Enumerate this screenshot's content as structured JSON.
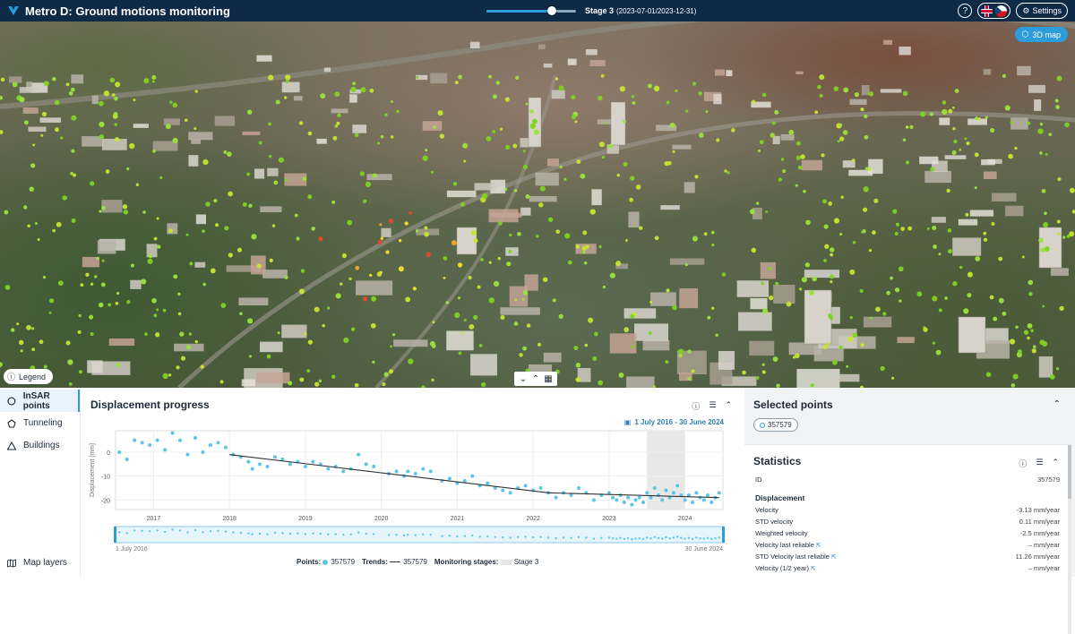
{
  "app": {
    "title": "Metro D: Ground motions monitoring"
  },
  "stage": {
    "label": "Stage 3",
    "dates": "(2023-07-01/2023-12-31)",
    "slider_fraction": 0.73
  },
  "header": {
    "help": "?",
    "settings_label": "Settings"
  },
  "map": {
    "button_3d": "3D map",
    "legend_label": "Legend"
  },
  "sidebar": {
    "items": [
      {
        "label": "InSAR points",
        "icon": "circle-icon",
        "active": true
      },
      {
        "label": "Tunneling",
        "icon": "pentagon-icon",
        "active": false
      },
      {
        "label": "Buildings",
        "icon": "triangle-icon",
        "active": false
      }
    ],
    "bottom_label": "Map layers"
  },
  "displacement": {
    "title": "Displacement progress",
    "date_range": "1 July 2016 - 30 June 2024",
    "range_start": "1 July 2016",
    "range_end": "30 June 2024",
    "legend": {
      "points_key": "Points:",
      "points_value": "357579",
      "trends_key": "Trends:",
      "trends_value": "357579",
      "stages_key": "Monitoring stages:",
      "stages_value": "Stage 3"
    }
  },
  "chart_data": {
    "type": "scatter",
    "ylabel": "Displacement [mm]",
    "xlabel": "",
    "title": "",
    "x_ticks": [
      "2017",
      "2018",
      "2019",
      "2020",
      "2021",
      "2022",
      "2023",
      "2024"
    ],
    "y_ticks": [
      0,
      -10,
      -20
    ],
    "xlim": [
      2016.5,
      2024.5
    ],
    "ylim": [
      -24,
      9
    ],
    "stage_band": [
      2023.5,
      2024.0
    ],
    "series": [
      {
        "name": "357579",
        "points": [
          [
            2016.55,
            0
          ],
          [
            2016.65,
            -3
          ],
          [
            2016.75,
            5
          ],
          [
            2016.85,
            4
          ],
          [
            2016.95,
            3
          ],
          [
            2017.05,
            5
          ],
          [
            2017.15,
            1
          ],
          [
            2017.25,
            8
          ],
          [
            2017.35,
            5
          ],
          [
            2017.45,
            -1
          ],
          [
            2017.55,
            6
          ],
          [
            2017.65,
            0
          ],
          [
            2017.75,
            3
          ],
          [
            2017.85,
            4
          ],
          [
            2017.95,
            2
          ],
          [
            2018.05,
            -1
          ],
          [
            2018.15,
            -2
          ],
          [
            2018.25,
            -4
          ],
          [
            2018.3,
            -7
          ],
          [
            2018.4,
            -5
          ],
          [
            2018.5,
            -6
          ],
          [
            2018.6,
            -2
          ],
          [
            2018.7,
            -3
          ],
          [
            2018.8,
            -5
          ],
          [
            2018.9,
            -4
          ],
          [
            2019.0,
            -6
          ],
          [
            2019.1,
            -4
          ],
          [
            2019.2,
            -5
          ],
          [
            2019.3,
            -7
          ],
          [
            2019.4,
            -6
          ],
          [
            2019.5,
            -8
          ],
          [
            2019.6,
            -7
          ],
          [
            2019.7,
            -1
          ],
          [
            2019.8,
            -5
          ],
          [
            2019.9,
            -6
          ],
          [
            2020.1,
            -9
          ],
          [
            2020.2,
            -8
          ],
          [
            2020.3,
            -10
          ],
          [
            2020.35,
            -8
          ],
          [
            2020.45,
            -9
          ],
          [
            2020.55,
            -7
          ],
          [
            2020.65,
            -8
          ],
          [
            2020.8,
            -12
          ],
          [
            2020.9,
            -11
          ],
          [
            2021.0,
            -13
          ],
          [
            2021.1,
            -12
          ],
          [
            2021.2,
            -10
          ],
          [
            2021.3,
            -14
          ],
          [
            2021.4,
            -13
          ],
          [
            2021.5,
            -15
          ],
          [
            2021.6,
            -16
          ],
          [
            2021.7,
            -17
          ],
          [
            2021.8,
            -15
          ],
          [
            2021.9,
            -14
          ],
          [
            2022.0,
            -16
          ],
          [
            2022.1,
            -15
          ],
          [
            2022.2,
            -17
          ],
          [
            2022.3,
            -19
          ],
          [
            2022.4,
            -17
          ],
          [
            2022.5,
            -18
          ],
          [
            2022.6,
            -15
          ],
          [
            2022.7,
            -17
          ],
          [
            2022.8,
            -20
          ],
          [
            2022.9,
            -18
          ],
          [
            2023.0,
            -17
          ],
          [
            2023.05,
            -19
          ],
          [
            2023.1,
            -20
          ],
          [
            2023.15,
            -18
          ],
          [
            2023.2,
            -21
          ],
          [
            2023.25,
            -19
          ],
          [
            2023.3,
            -22
          ],
          [
            2023.35,
            -20
          ],
          [
            2023.4,
            -19
          ],
          [
            2023.45,
            -21
          ],
          [
            2023.5,
            -17
          ],
          [
            2023.55,
            -19
          ],
          [
            2023.6,
            -15
          ],
          [
            2023.65,
            -18
          ],
          [
            2023.7,
            -20
          ],
          [
            2023.75,
            -16
          ],
          [
            2023.8,
            -19
          ],
          [
            2023.85,
            -17
          ],
          [
            2023.9,
            -14
          ],
          [
            2023.95,
            -18
          ],
          [
            2024.0,
            -20
          ],
          [
            2024.05,
            -18
          ],
          [
            2024.1,
            -21
          ],
          [
            2024.15,
            -17
          ],
          [
            2024.2,
            -19
          ],
          [
            2024.25,
            -20
          ],
          [
            2024.3,
            -18
          ],
          [
            2024.35,
            -21
          ],
          [
            2024.4,
            -19
          ],
          [
            2024.45,
            -17
          ]
        ]
      }
    ],
    "trend": [
      {
        "x": [
          2018.0,
          2022.2
        ],
        "y": [
          -1,
          -17
        ]
      },
      {
        "x": [
          2022.2,
          2024.45
        ],
        "y": [
          -17,
          -19
        ]
      }
    ]
  },
  "selected": {
    "title": "Selected points",
    "chip": "357579"
  },
  "statistics": {
    "title": "Statistics",
    "id_label": "ID",
    "id_value": "357579",
    "section": "Displacement",
    "rows": [
      {
        "label": "Velocity",
        "value": "-3.13 mm/year",
        "ext": false
      },
      {
        "label": "STD velocity",
        "value": "0.11 mm/year",
        "ext": false
      },
      {
        "label": "Weighted velocity",
        "value": "-2.5 mm/year",
        "ext": false
      },
      {
        "label": "Velocity last reliable",
        "value": "– mm/year",
        "ext": true
      },
      {
        "label": "STD Velocity last reliable",
        "value": "11.26 mm/year",
        "ext": true
      },
      {
        "label": "Velocity (1/2 year)",
        "value": "– mm/year",
        "ext": true
      }
    ],
    "ext_icon": "external-link-icon"
  },
  "colors": {
    "header": "#0e2a47",
    "accent": "#2d9cdb",
    "points": "#5bc6ea"
  }
}
